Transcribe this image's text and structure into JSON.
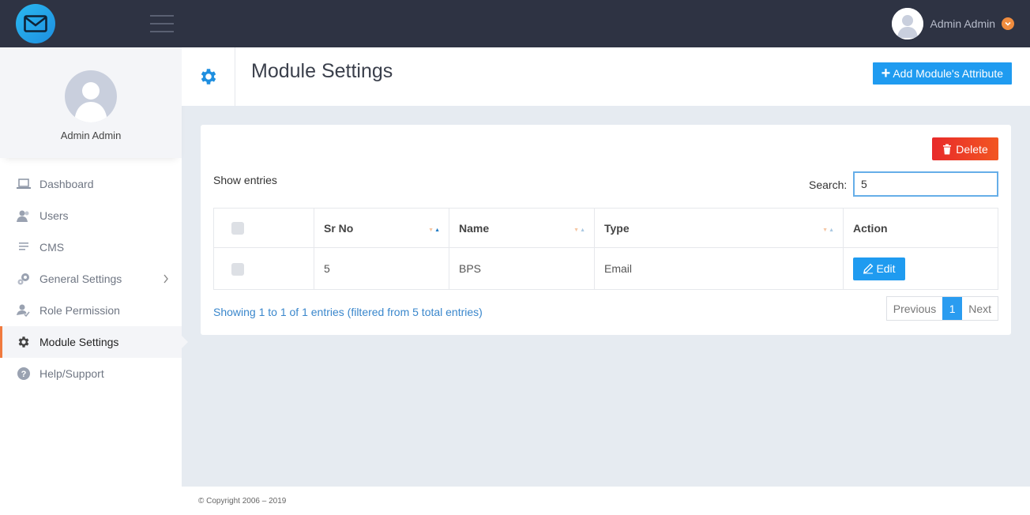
{
  "app": {
    "user_name": "Admin Admin"
  },
  "sidebar": {
    "profile_name": "Admin Admin",
    "items": [
      {
        "label": "Dashboard",
        "icon": "laptop-icon"
      },
      {
        "label": "Users",
        "icon": "users-icon"
      },
      {
        "label": "CMS",
        "icon": "document-lines-icon"
      },
      {
        "label": "General Settings",
        "icon": "gears-icon"
      },
      {
        "label": "Role Permission",
        "icon": "user-check-icon"
      },
      {
        "label": "Module Settings",
        "icon": "gear-icon",
        "active": true
      },
      {
        "label": "Help/Support",
        "icon": "question-icon"
      }
    ]
  },
  "header": {
    "title": "Module Settings",
    "add_label": "Add Module's Attribute"
  },
  "card": {
    "delete_label": "Delete",
    "show_entries": "Show entries",
    "search_label": "Search:",
    "search_value": "5",
    "columns": [
      "Sr No",
      "Name",
      "Type",
      "Action"
    ],
    "rows": [
      {
        "sr_no": "5",
        "name": "BPS",
        "type": "Email",
        "action": "Edit"
      }
    ],
    "info": "Showing 1 to 1 of 1 entries (filtered from 5 total entries)",
    "pager": {
      "previous": "Previous",
      "page": "1",
      "next": "Next"
    }
  },
  "footer": {
    "copyright": "© Copyright 2006 – 2019"
  },
  "colors": {
    "topbar": "#2e3343",
    "accent_blue": "#1f9bf0",
    "active_orange": "#f07a3e",
    "delete_red": "#e82a2a"
  }
}
